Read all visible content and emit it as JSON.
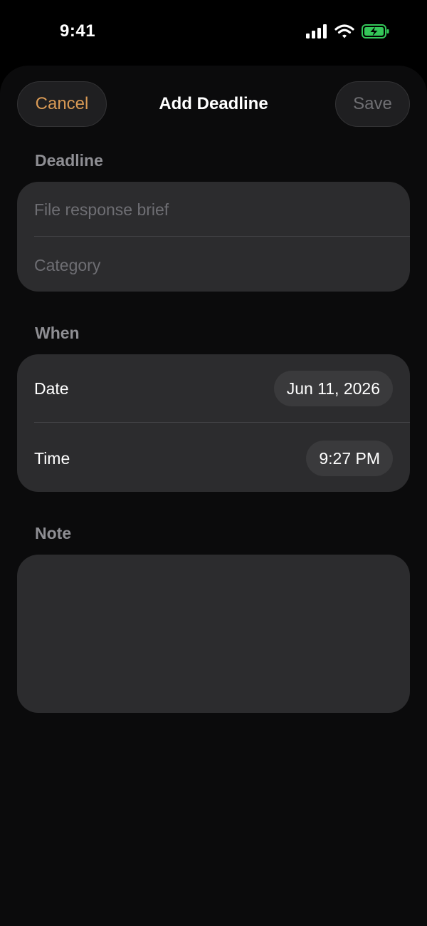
{
  "status_bar": {
    "time": "9:41",
    "icons": [
      "cellular-signal-icon",
      "wifi-icon",
      "battery-charging-icon"
    ],
    "battery_color": "#34c759"
  },
  "nav": {
    "cancel_label": "Cancel",
    "title": "Add Deadline",
    "save_label": "Save"
  },
  "deadline_section": {
    "header": "Deadline",
    "title_placeholder": "File response brief",
    "title_value": "",
    "category_placeholder": "Category",
    "category_value": ""
  },
  "when_section": {
    "header": "When",
    "date_label": "Date",
    "date_value": "Jun 11, 2026",
    "time_label": "Time",
    "time_value": "9:27 PM"
  },
  "note_section": {
    "header": "Note",
    "value": ""
  },
  "colors": {
    "accent": "#d99a55",
    "card": "#2c2c2e",
    "pill": "#3a3a3c",
    "section_label": "#8e8e93",
    "disabled": "#6f6f73"
  }
}
